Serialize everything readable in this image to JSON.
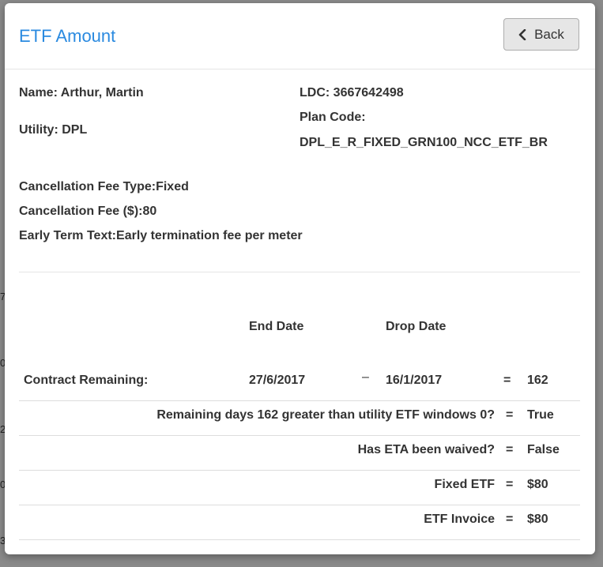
{
  "modal": {
    "title": "ETF Amount",
    "back_label": "Back"
  },
  "customer": {
    "name_label": "Name:",
    "name_value": "Arthur, Martin",
    "utility_label": "Utility:",
    "utility_value": "DPL",
    "ldc_label": "LDC:",
    "ldc_value": "3667642498",
    "plan_code_label": "Plan Code:",
    "plan_code_value": "DPL_E_R_FIXED_GRN100_NCC_ETF_BR"
  },
  "fees": {
    "type_label": "Cancellation Fee Type:",
    "type_value": "Fixed",
    "amount_label": "Cancellation Fee ($):",
    "amount_value": "80",
    "text_label": "Early Term Text:",
    "text_value": "Early termination fee per meter"
  },
  "calc": {
    "end_date_header": "End Date",
    "drop_date_header": "Drop Date",
    "contract_label": "Contract Remaining:",
    "end_date": "27/6/2017",
    "minus": "–",
    "drop_date": "16/1/2017",
    "equals": "=",
    "days": "162",
    "rows": [
      {
        "label": "Remaining days 162 greater than utility ETF windows 0?",
        "equals": "=",
        "value": "True"
      },
      {
        "label": "Has ETA been waived?",
        "equals": "=",
        "value": "False"
      },
      {
        "label": "Fixed ETF",
        "equals": "=",
        "value": "$80"
      },
      {
        "label": "ETF Invoice",
        "equals": "=",
        "value": "$80"
      }
    ]
  },
  "backdrop_fragments": [
    "7",
    "0",
    "2",
    "0",
    "3"
  ]
}
